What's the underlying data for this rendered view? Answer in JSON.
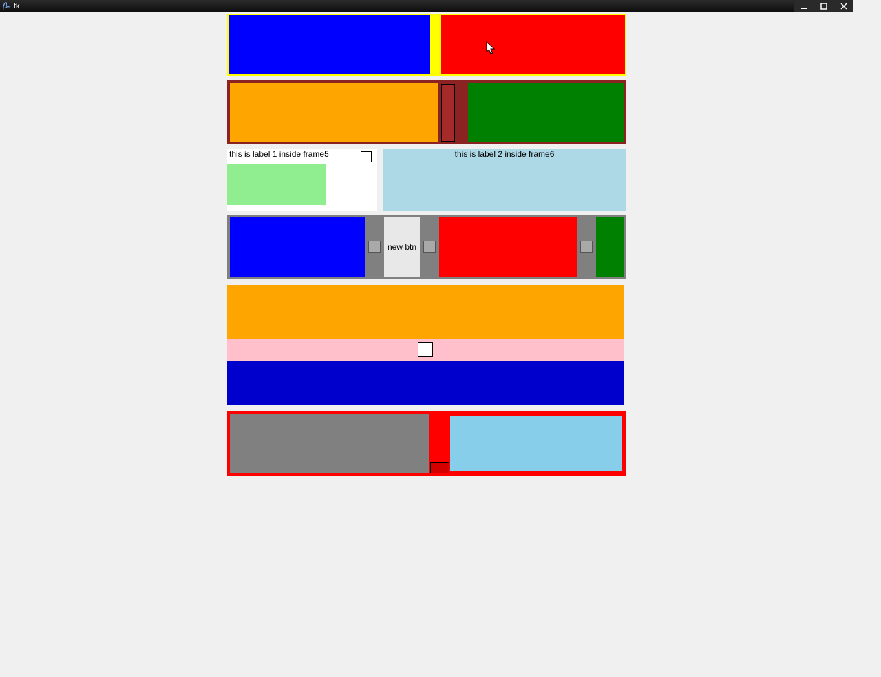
{
  "window": {
    "title": "tk"
  },
  "row3": {
    "label1": "this is label 1 inside frame5",
    "label2": "this is label 2 inside frame6"
  },
  "row4": {
    "new_btn": "new btn"
  }
}
